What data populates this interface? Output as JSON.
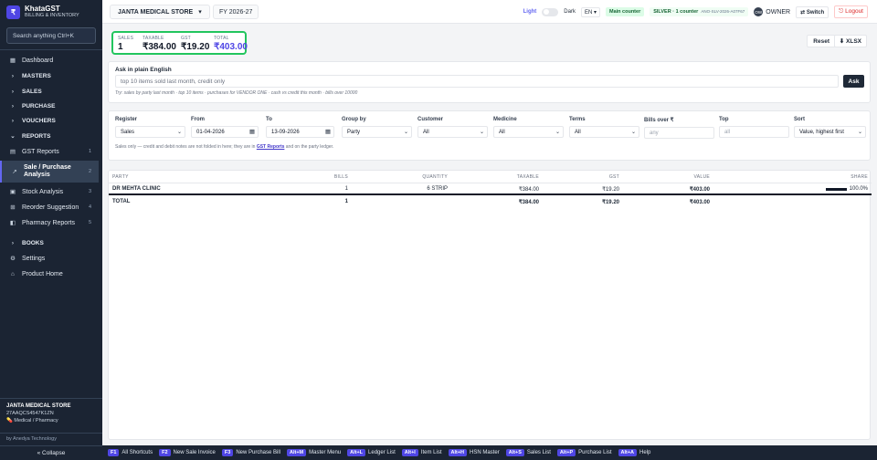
{
  "app": {
    "logo": "₹",
    "name": "KhataGST",
    "subtitle": "BILLING & INVENTORY",
    "search_placeholder": "Search anything  Ctrl+K"
  },
  "sidebar": {
    "items": [
      {
        "label": "Dashboard",
        "icon": "dashboard-icon",
        "glyph": "▦"
      },
      {
        "label": "MASTERS",
        "icon": "chevron-right-icon",
        "glyph": "›"
      },
      {
        "label": "SALES",
        "icon": "chevron-right-icon",
        "glyph": "›"
      },
      {
        "label": "PURCHASE",
        "icon": "chevron-right-icon",
        "glyph": "›"
      },
      {
        "label": "VOUCHERS",
        "icon": "chevron-right-icon",
        "glyph": "›"
      },
      {
        "label": "REPORTS",
        "icon": "chevron-down-icon",
        "glyph": "⌄"
      },
      {
        "label": "GST Reports",
        "icon": "file-icon",
        "glyph": "▤",
        "count": "1"
      },
      {
        "label": "Sale / Purchase Analysis",
        "icon": "trend-icon",
        "glyph": "↗",
        "count": "2"
      },
      {
        "label": "Stock Analysis",
        "icon": "box-icon",
        "glyph": "▣",
        "count": "3"
      },
      {
        "label": "Reorder Suggestion",
        "icon": "cart-icon",
        "glyph": "⊞",
        "count": "4"
      },
      {
        "label": "Pharmacy Reports",
        "icon": "pill-icon",
        "glyph": "◧",
        "count": "5"
      },
      {
        "label": "BOOKS",
        "icon": "chevron-right-icon",
        "glyph": "›"
      },
      {
        "label": "Settings",
        "icon": "gear-icon",
        "glyph": "⚙"
      },
      {
        "label": "Product Home",
        "icon": "home-icon",
        "glyph": "⌂"
      }
    ],
    "store_name": "JANTA MEDICAL STORE",
    "store_gstin": "27AAQCS4547K1ZN",
    "store_type": "💊 Medical / Pharmacy",
    "powered_by": "by Anedya Technology",
    "collapse_label": "« Collapse"
  },
  "topbar": {
    "store": "JANTA MEDICAL STORE",
    "store_caret": "▾",
    "fy": "FY 2026-27",
    "theme_light": "Light",
    "theme_dark": "Dark",
    "lang": "EN ▾",
    "counter": "Main counter",
    "license": "SILVER · 1 counter",
    "license_key": "ANO-SLV-2026-A07F67",
    "avatar": "OW",
    "role": "OWNER",
    "switch_label": "⇄ Switch",
    "logout_label": "⎋ Logout"
  },
  "summary": {
    "sales_label": "SALES",
    "sales_value": "1",
    "taxable_label": "TAXABLE",
    "taxable_value": "₹384.00",
    "gst_label": "GST",
    "gst_value": "₹19.20",
    "total_label": "TOTAL",
    "total_value": "₹403.00",
    "reset_label": "Reset",
    "xlsx_label": "⬇ XLSX"
  },
  "ask": {
    "title": "Ask in plain English",
    "placeholder": "top 10 items sold last month, credit only",
    "button": "Ask",
    "hint": "Try: sales by party last month · top 10 items · purchases for VENDOR ONE · cash vs credit this month · bills over 10000"
  },
  "filters": {
    "register_label": "Register",
    "register_value": "Sales",
    "from_label": "From",
    "from_value": "01-04-2026",
    "to_label": "To",
    "to_value": "13-09-2026",
    "groupby_label": "Group by",
    "groupby_value": "Party",
    "customer_label": "Customer",
    "customer_value": "All",
    "medicine_label": "Medicine",
    "medicine_value": "All",
    "terms_label": "Terms",
    "terms_value": "All",
    "billsover_label": "Bills over ₹",
    "billsover_placeholder": "any",
    "top_label": "Top",
    "top_placeholder": "all",
    "sort_label": "Sort",
    "sort_value": "Value, highest first",
    "note_prefix": "Sales only — credit and debit notes are not folded in here; they are in",
    "note_link": "GST Reports",
    "note_suffix": "and on the party ledger."
  },
  "table": {
    "headers": [
      "PARTY",
      "BILLS",
      "QUANTITY",
      "TAXABLE",
      "GST",
      "VALUE",
      "SHARE"
    ],
    "rows": [
      {
        "party": "DR MEHTA CLINIC",
        "bills": "1",
        "quantity": "6 STRIP",
        "taxable": "₹384.00",
        "gst": "₹19.20",
        "value": "₹403.00",
        "share": "100.0%",
        "share_fraction": 1.0
      }
    ],
    "total": {
      "label": "TOTAL",
      "bills": "1",
      "taxable": "₹384.00",
      "gst": "₹19.20",
      "value": "₹403.00"
    }
  },
  "shortcuts": [
    {
      "key": "F1",
      "label": "All Shortcuts"
    },
    {
      "key": "F2",
      "label": "New Sale Invoice"
    },
    {
      "key": "F3",
      "label": "New Purchase Bill"
    },
    {
      "key": "Alt+M",
      "label": "Master Menu"
    },
    {
      "key": "Alt+L",
      "label": "Ledger List"
    },
    {
      "key": "Alt+I",
      "label": "Item List"
    },
    {
      "key": "Alt+H",
      "label": "HSN Master"
    },
    {
      "key": "Alt+S",
      "label": "Sales List"
    },
    {
      "key": "Alt+P",
      "label": "Purchase List"
    },
    {
      "key": "Alt+A",
      "label": "Help"
    }
  ],
  "colors": {
    "accent": "#4f46e5",
    "highlight_border": "#22c55e",
    "sidebar_bg": "#1b2433",
    "logout": "#dc2626"
  }
}
